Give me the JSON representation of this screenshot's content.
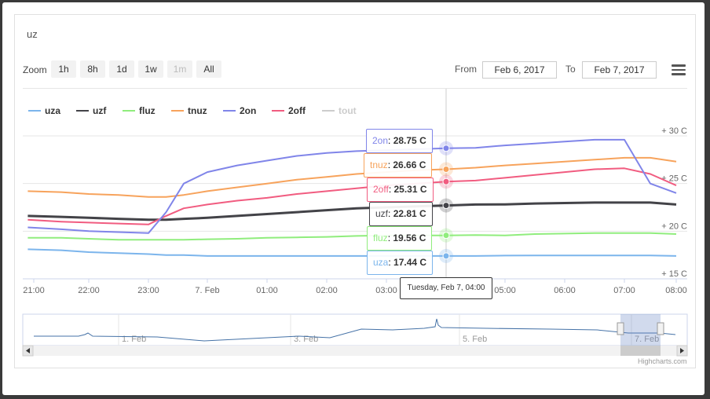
{
  "title": "uz",
  "zoom": {
    "label": "Zoom",
    "buttons": [
      {
        "label": "1h",
        "enabled": true
      },
      {
        "label": "8h",
        "enabled": true
      },
      {
        "label": "1d",
        "enabled": true
      },
      {
        "label": "1w",
        "enabled": true
      },
      {
        "label": "1m",
        "enabled": false
      },
      {
        "label": "All",
        "enabled": true
      }
    ]
  },
  "range": {
    "from_label": "From",
    "from_value": "Feb 6, 2017",
    "to_label": "To",
    "to_value": "Feb 7, 2017"
  },
  "menu_icon": "hamburger-menu-icon",
  "tooltip_header": "Tuesday, Feb 7, 04:00",
  "credits": "Highcharts.com",
  "navigator": {
    "labels": [
      "1. Feb",
      "3. Feb",
      "5. Feb",
      "7. Feb"
    ],
    "scroll_left_icon": "arrow-left-icon",
    "scroll_right_icon": "arrow-right-icon"
  },
  "chart_data": {
    "type": "line",
    "title": "uz",
    "x_ticks": [
      "21:00",
      "22:00",
      "23:00",
      "7. Feb",
      "01:00",
      "02:00",
      "03:00",
      "04:00",
      "05:00",
      "06:00",
      "07:00",
      "08:00"
    ],
    "y_ticks": [
      "+ 15 C",
      "+ 20 C",
      "+ 25 C",
      "+ 30 C"
    ],
    "ylim": [
      15,
      30
    ],
    "legend_position": "top-left",
    "x_hours": [
      20.9,
      21.5,
      22.0,
      22.5,
      23.0,
      23.3,
      23.6,
      24.0,
      24.5,
      25.0,
      25.5,
      26.0,
      26.5,
      27.0,
      27.5,
      28.0,
      28.5,
      29.0,
      29.5,
      30.0,
      30.5,
      31.0,
      31.5,
      32.0
    ],
    "series": [
      {
        "name": "uza",
        "color": "#7cb5ec",
        "visible": true,
        "tooltip": "17.44 C",
        "values": [
          18.1,
          18.0,
          17.8,
          17.7,
          17.6,
          17.5,
          17.5,
          17.4,
          17.4,
          17.4,
          17.4,
          17.4,
          17.4,
          17.4,
          17.4,
          17.4,
          17.4,
          17.44,
          17.45,
          17.45,
          17.45,
          17.45,
          17.45,
          17.4
        ]
      },
      {
        "name": "uzf",
        "color": "#434348",
        "visible": true,
        "tooltip": "22.81 C",
        "values": [
          21.6,
          21.5,
          21.4,
          21.3,
          21.2,
          21.2,
          21.3,
          21.4,
          21.6,
          21.8,
          22.0,
          22.2,
          22.4,
          22.5,
          22.6,
          22.7,
          22.8,
          22.81,
          22.9,
          22.95,
          23.0,
          23.0,
          23.0,
          22.8
        ]
      },
      {
        "name": "fluz",
        "color": "#90ed7d",
        "visible": true,
        "tooltip": "19.56 C",
        "values": [
          19.3,
          19.3,
          19.2,
          19.1,
          19.1,
          19.1,
          19.1,
          19.15,
          19.2,
          19.3,
          19.35,
          19.4,
          19.5,
          19.55,
          19.55,
          19.56,
          19.6,
          19.56,
          19.7,
          19.75,
          19.8,
          19.8,
          19.8,
          19.7
        ]
      },
      {
        "name": "tnuz",
        "color": "#f7a35c",
        "visible": true,
        "tooltip": "26.66 C",
        "values": [
          24.2,
          24.1,
          23.9,
          23.8,
          23.6,
          23.6,
          23.8,
          24.2,
          24.6,
          25.0,
          25.4,
          25.7,
          26.0,
          26.2,
          26.4,
          26.5,
          26.66,
          26.9,
          27.1,
          27.3,
          27.5,
          27.7,
          27.7,
          27.3
        ]
      },
      {
        "name": "2on",
        "color": "#8085e9",
        "visible": true,
        "tooltip": "28.75 C",
        "values": [
          20.4,
          20.2,
          20.0,
          19.9,
          19.8,
          22.0,
          25.0,
          26.2,
          26.9,
          27.4,
          27.9,
          28.2,
          28.4,
          28.5,
          28.6,
          28.7,
          28.75,
          29.0,
          29.2,
          29.4,
          29.6,
          29.6,
          25.0,
          24.0
        ]
      },
      {
        "name": "2off",
        "color": "#f15c80",
        "visible": true,
        "tooltip": "25.31 C",
        "values": [
          21.2,
          21.0,
          20.9,
          20.8,
          20.7,
          21.6,
          22.4,
          22.8,
          23.2,
          23.5,
          23.9,
          24.2,
          24.5,
          24.8,
          25.0,
          25.2,
          25.31,
          25.6,
          25.9,
          26.2,
          26.5,
          26.6,
          26.0,
          24.8
        ]
      },
      {
        "name": "tout",
        "color": "#cccccc",
        "visible": false,
        "tooltip": "",
        "values": []
      }
    ],
    "hover_x_hour": 28.0
  }
}
